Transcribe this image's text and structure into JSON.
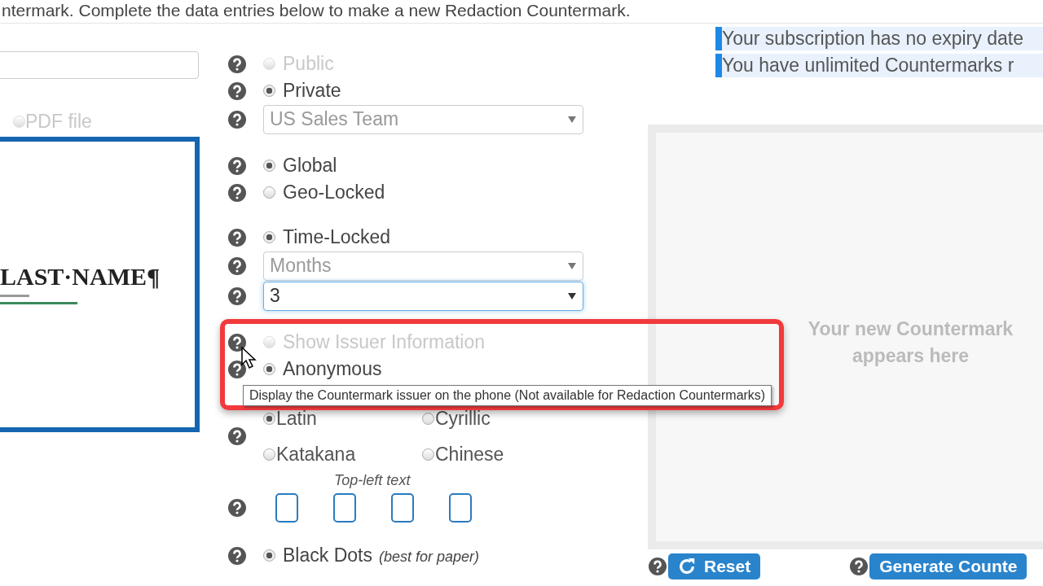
{
  "header": {
    "text": "ntermark. Complete the data entries below to make a new Redaction Countermark."
  },
  "left": {
    "file_options": [
      {
        "label": "PDF file",
        "selected": false,
        "disabled": true
      }
    ],
    "preview": {
      "title": "LAST·NAME¶"
    }
  },
  "sections": [
    {
      "rows": [
        {
          "kind": "radio",
          "label": "Public",
          "selected": false,
          "disabled": true
        },
        {
          "kind": "radio",
          "label": "Private",
          "selected": true,
          "disabled": false
        },
        {
          "kind": "select",
          "value": "US Sales Team",
          "disabled": true,
          "focused": false
        }
      ]
    },
    {
      "rows": [
        {
          "kind": "radio",
          "label": "Global",
          "selected": true,
          "disabled": false
        },
        {
          "kind": "radio",
          "label": "Geo-Locked",
          "selected": false,
          "disabled": false
        }
      ]
    },
    {
      "rows": [
        {
          "kind": "radio",
          "label": "Time-Locked",
          "selected": true,
          "disabled": false
        },
        {
          "kind": "select",
          "value": "Months",
          "disabled": true,
          "focused": false
        },
        {
          "kind": "select",
          "value": "3",
          "disabled": false,
          "focused": true
        }
      ]
    },
    {
      "rows": [
        {
          "kind": "radio",
          "label": "Show Issuer Information",
          "selected": false,
          "disabled": true
        },
        {
          "kind": "radio",
          "label": "Anonymous",
          "selected": true,
          "disabled": false
        }
      ]
    }
  ],
  "alphabets": [
    {
      "label": "Latin",
      "selected": true
    },
    {
      "label": "Cyrillic",
      "selected": false
    },
    {
      "label": "Katakana",
      "selected": false
    },
    {
      "label": "Chinese",
      "selected": false
    }
  ],
  "corner_text": {
    "caption": "Top-left text",
    "boxes": [
      {
        "kind": "box"
      },
      {
        "kind": "box"
      },
      {
        "kind": "box"
      },
      {
        "kind": "box"
      }
    ]
  },
  "dots": [
    {
      "label": "Black Dots",
      "note": "(best for paper)",
      "selected": true
    }
  ],
  "notices": [
    "Your subscription has no expiry date",
    "You have unlimited Countermarks r"
  ],
  "result": {
    "message": "Your new Countermark appears here"
  },
  "buttons": [
    {
      "kind": "reset",
      "label": "Reset"
    },
    {
      "kind": "generate",
      "label": "Generate Counte"
    }
  ],
  "tooltip": {
    "text": "Display the Countermark issuer on the phone (Not available for Redaction Countermarks)"
  }
}
